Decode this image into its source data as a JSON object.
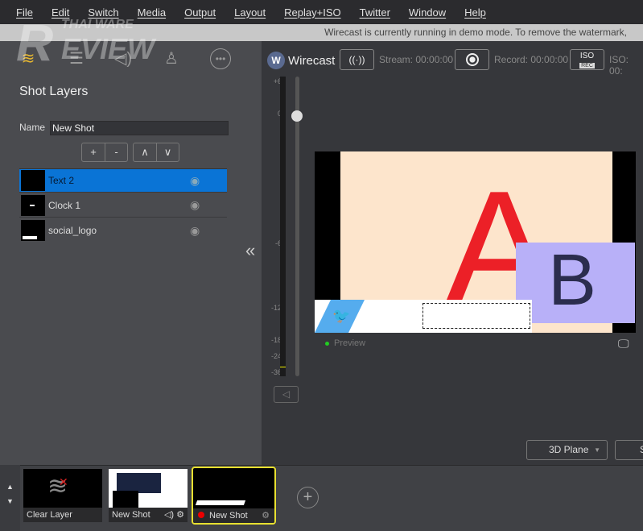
{
  "menu": [
    "File",
    "Edit",
    "Switch",
    "Media",
    "Output",
    "Layout",
    "Replay+ISO",
    "Twitter",
    "Window",
    "Help"
  ],
  "banner": "Wirecast is currently running in demo mode. To remove the watermark,",
  "watermark": "THAIWARE REVIEW",
  "left_panel": {
    "title": "Shot Layers",
    "name_label": "Name",
    "name_value": "New Shot",
    "add": "+",
    "remove": "-",
    "up": "∧",
    "down": "∨",
    "layers": [
      {
        "name": "Text 2",
        "selected": true
      },
      {
        "name": "Clock 1"
      },
      {
        "name": "social_logo"
      }
    ],
    "collapse": "«"
  },
  "toolbar": {
    "logo": "Wirecast",
    "stream": "Stream: 00:00:00",
    "record": "Record: 00:00:00",
    "iso_btn": "ISO",
    "iso_rec": "REC",
    "iso": "ISO: 00:"
  },
  "audio_scale": [
    "+6",
    "0",
    "-6",
    "-12",
    "-18",
    "-24",
    "-36"
  ],
  "audio_level": 0.1,
  "canvas": {
    "letter_a": "A",
    "letter_b": "B",
    "colors": {
      "bg": "#fde5cc",
      "a": "#ec2027",
      "b_box": "#b8b0f8",
      "twitter": "#55acee"
    }
  },
  "preview_label": "Preview",
  "transition": {
    "value": "3D Plane",
    "next": "S"
  },
  "shots": [
    {
      "label": "Clear Layer"
    },
    {
      "label": "New Shot"
    },
    {
      "label": "New Shot",
      "live": true,
      "selected": true
    }
  ],
  "add_shot": "+",
  "accent": "#0a74d6",
  "highlight": "#e8e030"
}
